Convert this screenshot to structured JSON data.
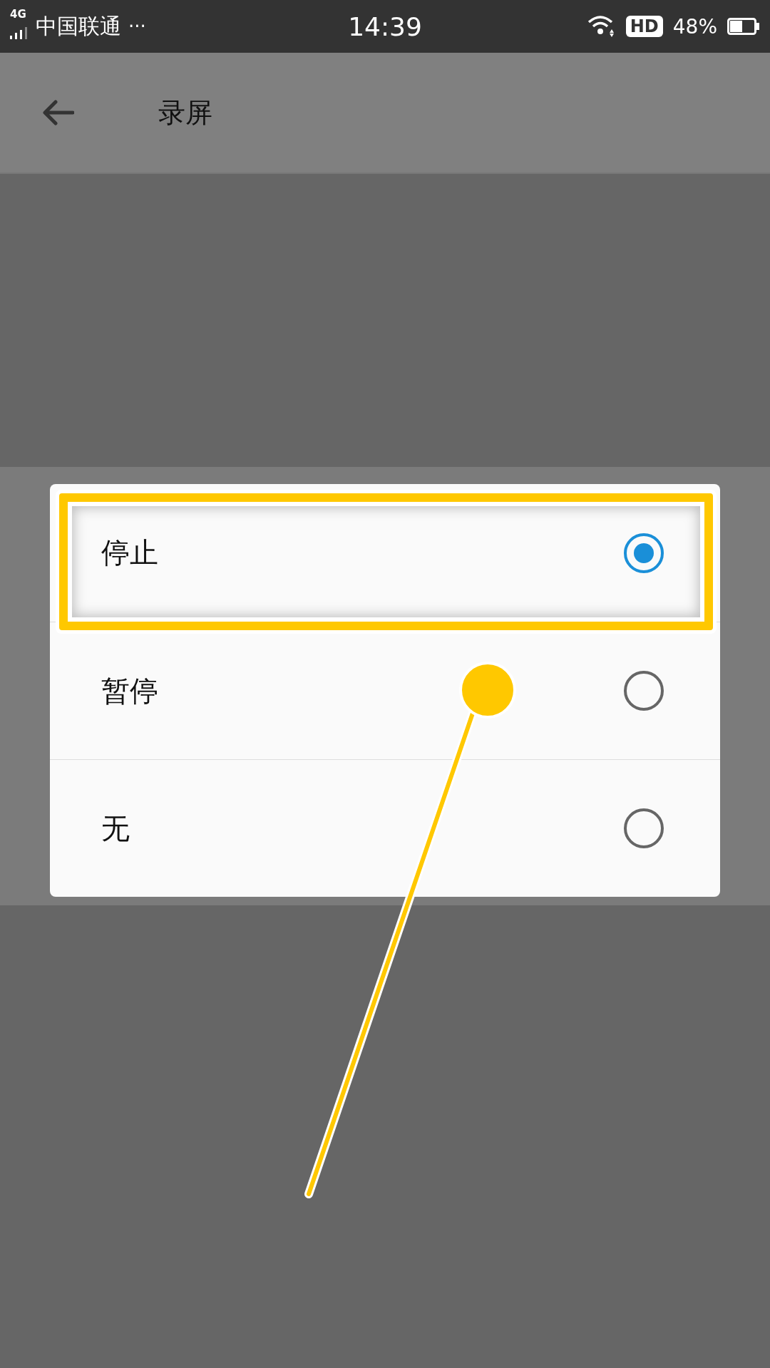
{
  "status_bar": {
    "network": "4G",
    "carrier": "中国联通",
    "more": "···",
    "time": "14:39",
    "hd": "HD",
    "battery": "48%"
  },
  "app_bar": {
    "title": "录屏"
  },
  "dialog": {
    "options": [
      {
        "label": "停止",
        "selected": true
      },
      {
        "label": "暂停",
        "selected": false
      },
      {
        "label": "无",
        "selected": false
      }
    ]
  }
}
